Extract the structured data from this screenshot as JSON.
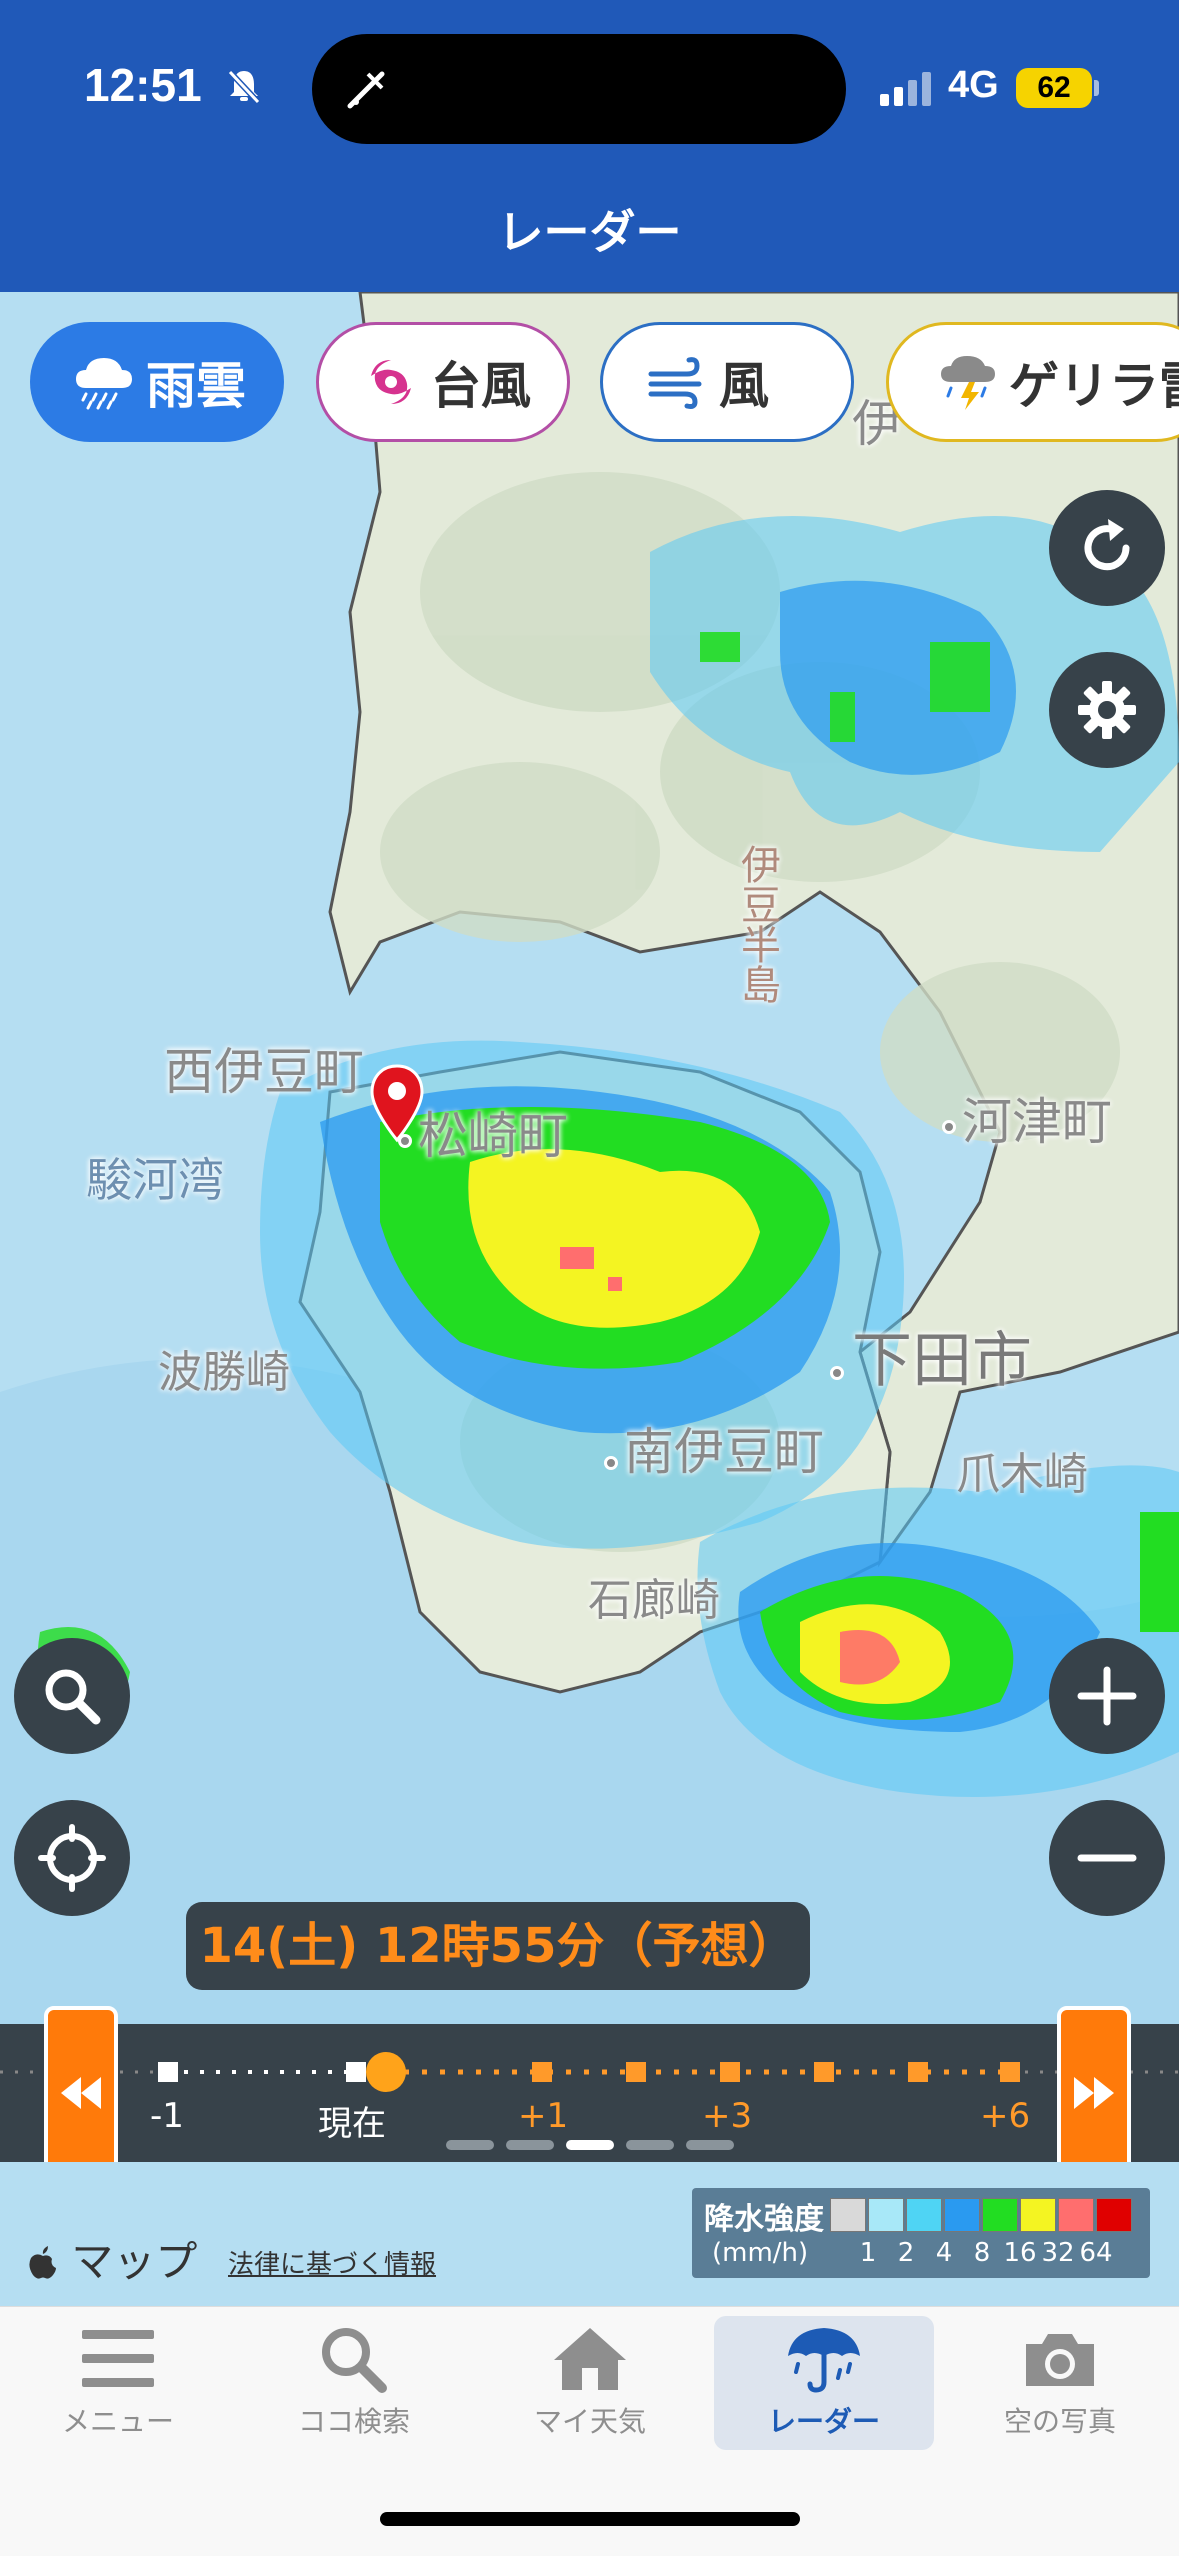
{
  "status_bar": {
    "time": "12:51",
    "network": "4G",
    "battery": "62"
  },
  "header": {
    "title": "レーダー"
  },
  "layers": [
    {
      "label": "雨雲",
      "icon": "rain-cloud-icon",
      "active": true
    },
    {
      "label": "台風",
      "icon": "typhoon-icon",
      "active": false
    },
    {
      "label": "風",
      "icon": "wind-icon",
      "active": false
    },
    {
      "label": "ゲリラ雷",
      "icon": "thunder-cloud-icon",
      "active": false
    }
  ],
  "map": {
    "places": {
      "nishiizu": "西伊豆町",
      "matsuzaki": "松崎町",
      "surugawan": "駿河湾",
      "kawazu": "河津町",
      "hashomisaki": "波勝崎",
      "shimoda": "下田市",
      "minamiizu": "南伊豆町",
      "tsumekisaki": "爪木崎",
      "irozaki": "石廊崎",
      "izuhanto": "伊豆半島",
      "ito": "伊"
    }
  },
  "forecast": {
    "label": "14(土) 12時55分（予想）"
  },
  "timeline": {
    "labels": [
      "-1",
      "現在",
      "+1",
      "+3",
      "+6"
    ],
    "pages": 5,
    "active_page": 2
  },
  "credits": {
    "apple_maps": "マップ",
    "legal": "法律に基づく情報"
  },
  "legend": {
    "title": "降水強度",
    "unit": "(mm/h)",
    "scale": [
      "1",
      "2",
      "4",
      "8",
      "16",
      "32",
      "64"
    ],
    "colors": [
      "#d9d9d9",
      "#a8e8f8",
      "#4fd4f4",
      "#2a9af0",
      "#22dd22",
      "#f4f422",
      "#ff6e6e",
      "#e00000"
    ]
  },
  "tabs": [
    {
      "label": "メニュー",
      "icon": "menu-icon",
      "active": false
    },
    {
      "label": "ココ検索",
      "icon": "search-icon",
      "active": false
    },
    {
      "label": "マイ天気",
      "icon": "home-icon",
      "active": false
    },
    {
      "label": "レーダー",
      "icon": "umbrella-icon",
      "active": true
    },
    {
      "label": "空の写真",
      "icon": "camera-icon",
      "active": false
    }
  ]
}
